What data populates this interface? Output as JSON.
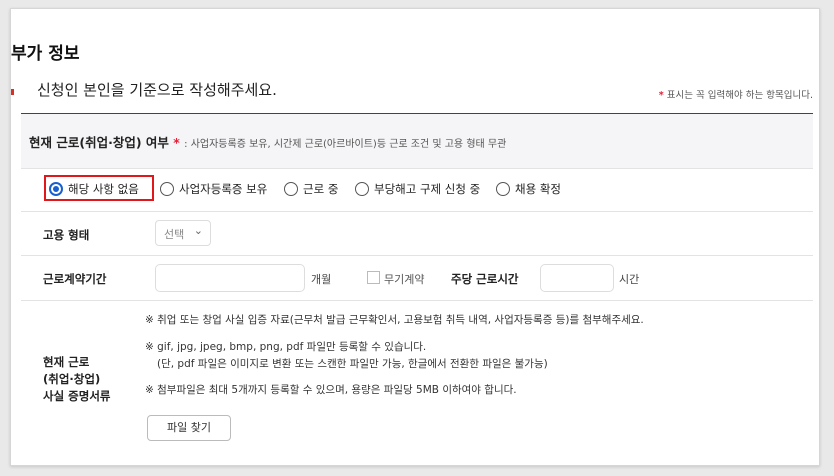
{
  "section_title": "부가 정보",
  "instruction": "신청인 본인을 기준으로 작성해주세요.",
  "required_note": {
    "star": "*",
    "text": " 표시는 꼭 입력해야 하는 항목입니다."
  },
  "employment_status": {
    "label": "현재 근로(취업·창업) 여부",
    "star": "*",
    "subtext": ": 사업자등록증 보유, 시간제 근로(아르바이트)등 근로 조건 및 고용 형태 무관",
    "options": [
      {
        "label": "해당 사항 없음",
        "checked": true
      },
      {
        "label": "사업자등록증 보유",
        "checked": false
      },
      {
        "label": "근로 중",
        "checked": false
      },
      {
        "label": "부당해고 구제 신청 중",
        "checked": false
      },
      {
        "label": "채용 확정",
        "checked": false
      }
    ]
  },
  "employment_type": {
    "label": "고용 형태",
    "select_value": "선택",
    "chevron_icon": "chevron-down-icon"
  },
  "contract_period": {
    "label": "근로계약기간",
    "input_value": "",
    "unit": "개월",
    "indefinite_label": "무기계약",
    "weekly_hours_label": "주당 근로시간",
    "weekly_hours_value": "",
    "hours_unit": "시간"
  },
  "proof_documents": {
    "label_lines": [
      "현재 근로",
      "(취업·창업)",
      "사실 증명서류"
    ],
    "notes": [
      "※ 취업 또는 창업 사실 입증 자료(근무처 발급 근무확인서, 고용보험 취득 내역, 사업자등록증 등)를 첨부해주세요.",
      "※ gif, jpg, jpeg, bmp, png, pdf 파일만 등록할 수 있습니다.",
      "(단, pdf 파일은 이미지로 변환 또는 스캔한 파일만 가능, 한글에서 전환한 파일은 불가능)",
      "※ 첨부파일은 최대 5개까지 등록할 수 있으며, 용량은 파일당 5MB 이하여야 합니다."
    ],
    "file_button": "파일 찾기"
  }
}
